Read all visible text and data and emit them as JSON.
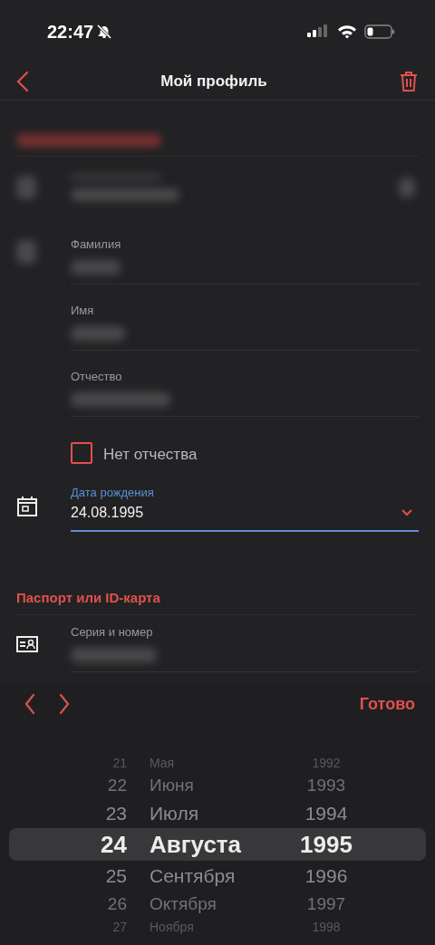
{
  "status_bar": {
    "time": "22:47"
  },
  "header": {
    "title": "Мой профиль"
  },
  "personal": {
    "fields": [
      {
        "label": "Фамилия"
      },
      {
        "label": "Имя"
      },
      {
        "label": "Отчество"
      }
    ],
    "no_patronymic": {
      "label": "Нет отчества",
      "checked": false
    },
    "birth_date": {
      "label": "Дата рождения",
      "value": "24.08.1995",
      "focused": true
    }
  },
  "passport": {
    "heading": "Паспорт или ID-карта",
    "fields": [
      {
        "label": "Серия и номер"
      }
    ]
  },
  "picker_toolbar": {
    "done": "Готово"
  },
  "picker": {
    "rows": [
      {
        "day": "21",
        "month": "Мая",
        "year": "1992",
        "selected": false
      },
      {
        "day": "22",
        "month": "Июня",
        "year": "1993",
        "selected": false
      },
      {
        "day": "23",
        "month": "Июля",
        "year": "1994",
        "selected": false
      },
      {
        "day": "24",
        "month": "Августа",
        "year": "1995",
        "selected": true
      },
      {
        "day": "25",
        "month": "Сентября",
        "year": "1996",
        "selected": false
      },
      {
        "day": "26",
        "month": "Октября",
        "year": "1997",
        "selected": false
      },
      {
        "day": "27",
        "month": "Ноября",
        "year": "1998",
        "selected": false
      }
    ]
  }
}
